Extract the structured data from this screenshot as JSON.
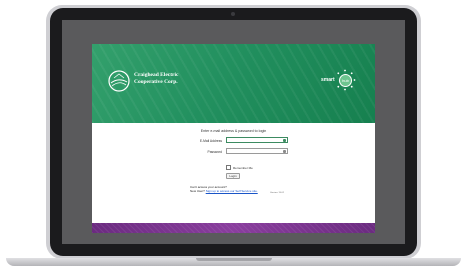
{
  "header": {
    "org_name_line1": "Craighead Electric",
    "org_name_line2": "Cooperative Corp.",
    "smarthub_word": "smart",
    "smarthub_badge": "hub"
  },
  "login": {
    "prompt": "Enter e-mail address & password to login",
    "email_label": "E-Mail Address",
    "email_value": "",
    "password_label": "Password",
    "password_value": "",
    "remember_label": "Remember Me",
    "login_button": "Login",
    "help_line1": "Can't access your account?",
    "help_line2_prefix": "New User?",
    "help_line2_link": "Sign up to access our Self Service site.",
    "version": "Version: 15.02"
  },
  "colors": {
    "header_green": "#22905f",
    "footer_purple": "#7a3590",
    "field_focus": "#3c8b61"
  },
  "icons": [
    "coop-logo-icon",
    "smarthub-logo-icon",
    "credential-key-icon"
  ]
}
